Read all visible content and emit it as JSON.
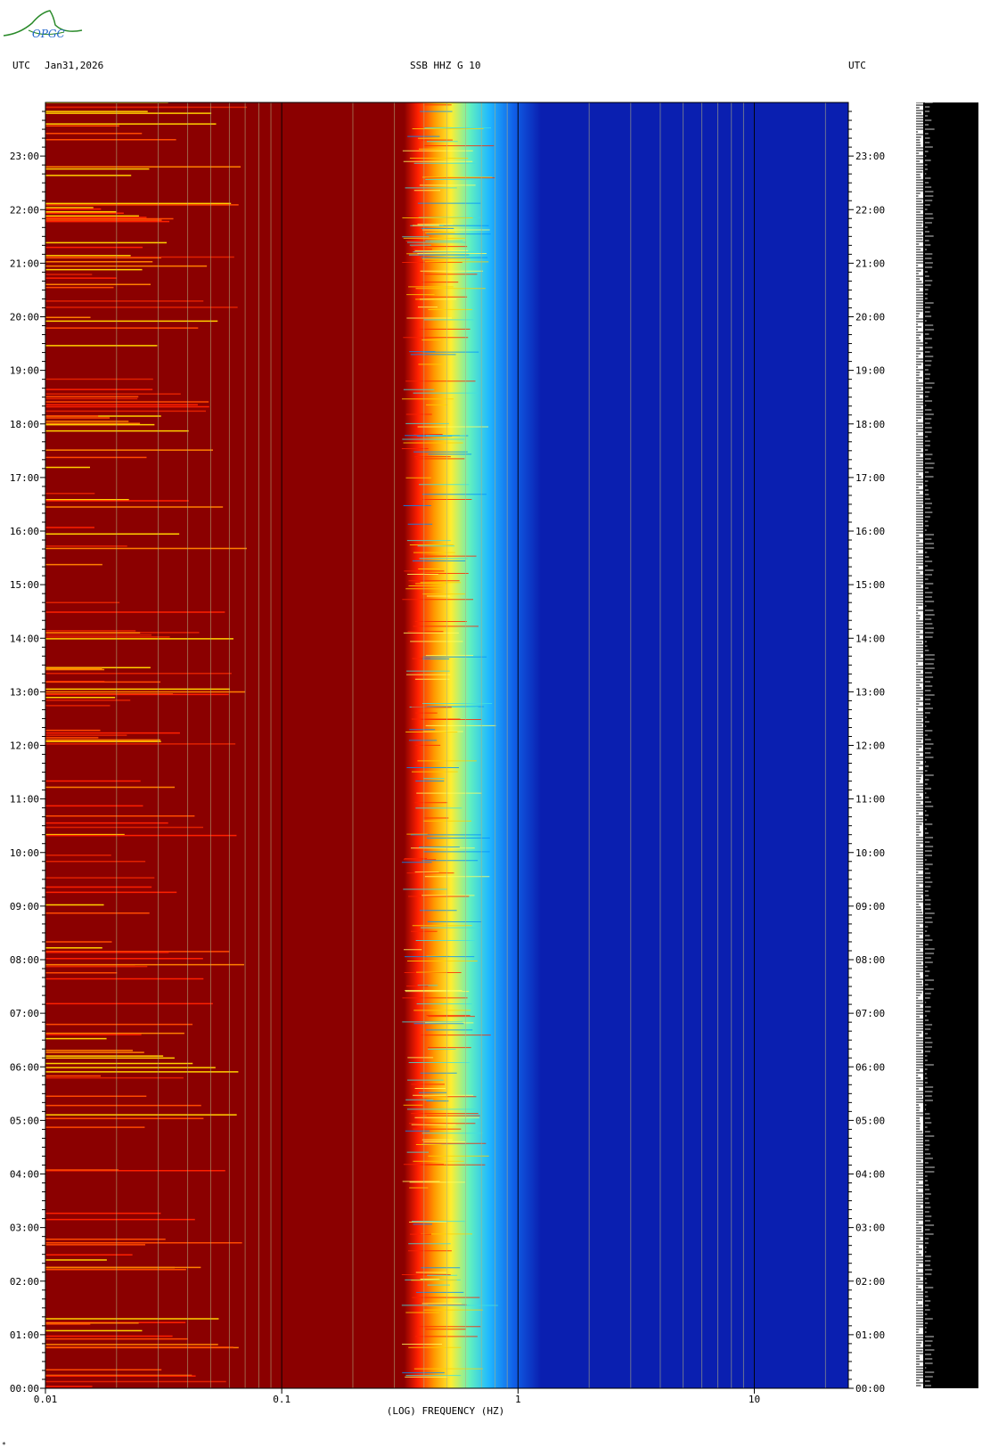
{
  "header": {
    "left_tz": "UTC",
    "date": "Jan31,2026",
    "station": "SSB HHZ G 10",
    "right_tz": "UTC"
  },
  "logo": {
    "text": "OPGC"
  },
  "footer_mark": "*",
  "colors": {
    "low_freq": "#8b0000",
    "high_freq": "#0a1fb0",
    "noise_band": [
      "#ff2000",
      "#ffd000",
      "#ffff60",
      "#40e0e0",
      "#0090ff"
    ],
    "seismogram": "#000000"
  },
  "chart_data": {
    "type": "heatmap",
    "xlabel": "(LOG) FREQUENCY (HZ)",
    "x_scale": "log",
    "xlim": [
      0.01,
      25
    ],
    "x_ticks": [
      {
        "value": 0.01,
        "label": "0.01"
      },
      {
        "value": 0.1,
        "label": "0.1"
      },
      {
        "value": 1,
        "label": "1"
      },
      {
        "value": 10,
        "label": "10"
      }
    ],
    "ylim": [
      "00:00",
      "24:00"
    ],
    "y_ticks": [
      "00:00",
      "01:00",
      "02:00",
      "03:00",
      "04:00",
      "05:00",
      "06:00",
      "07:00",
      "08:00",
      "09:00",
      "10:00",
      "11:00",
      "12:00",
      "13:00",
      "14:00",
      "15:00",
      "16:00",
      "17:00",
      "18:00",
      "19:00",
      "20:00",
      "21:00",
      "22:00",
      "23:00"
    ],
    "y_tick_values": [
      0,
      1,
      2,
      3,
      4,
      5,
      6,
      7,
      8,
      9,
      10,
      11,
      12,
      13,
      14,
      15,
      16,
      17,
      18,
      19,
      20,
      21,
      22,
      23
    ],
    "microseism_peak_hz": [
      0.4,
      0.9
    ],
    "grid": true
  }
}
